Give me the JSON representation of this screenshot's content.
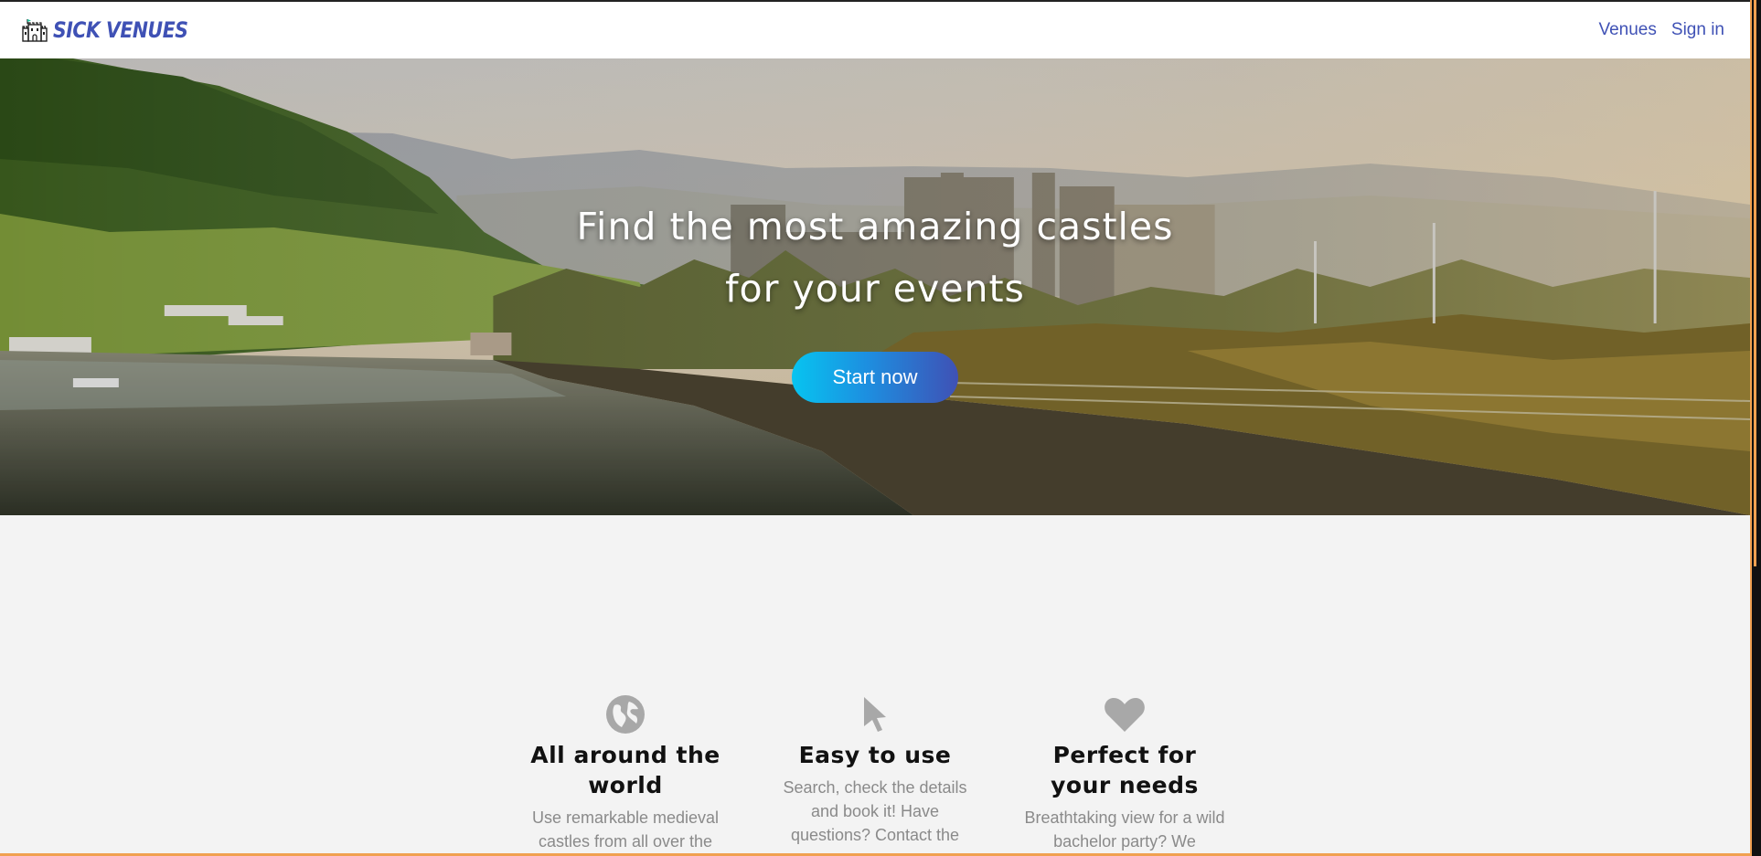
{
  "brand": {
    "name": "Sick Venues",
    "logo_icon": "castle-icon"
  },
  "nav": {
    "links": [
      {
        "label": "Venues"
      },
      {
        "label": "Sign in"
      }
    ]
  },
  "hero": {
    "title_line1": "Find the most amazing castles",
    "title_line2": "for your events",
    "cta_label": "Start now"
  },
  "features": [
    {
      "icon": "globe-icon",
      "title": "All around the world",
      "text": "Use remarkable medieval castles from all over the"
    },
    {
      "icon": "cursor-icon",
      "title": "Easy to use",
      "text": "Search, check the details and book it! Have questions? Contact the"
    },
    {
      "icon": "heart-icon",
      "title": "Perfect for your needs",
      "text": "Breathtaking view for a wild bachelor party? We"
    }
  ],
  "colors": {
    "brand": "#3f51b5",
    "cta_start": "#07c4f0",
    "cta_end": "#3f51b5",
    "page_bg": "#f3f3f3",
    "muted_text": "#8a8a8a",
    "icon_gray": "#a8a8a8"
  }
}
